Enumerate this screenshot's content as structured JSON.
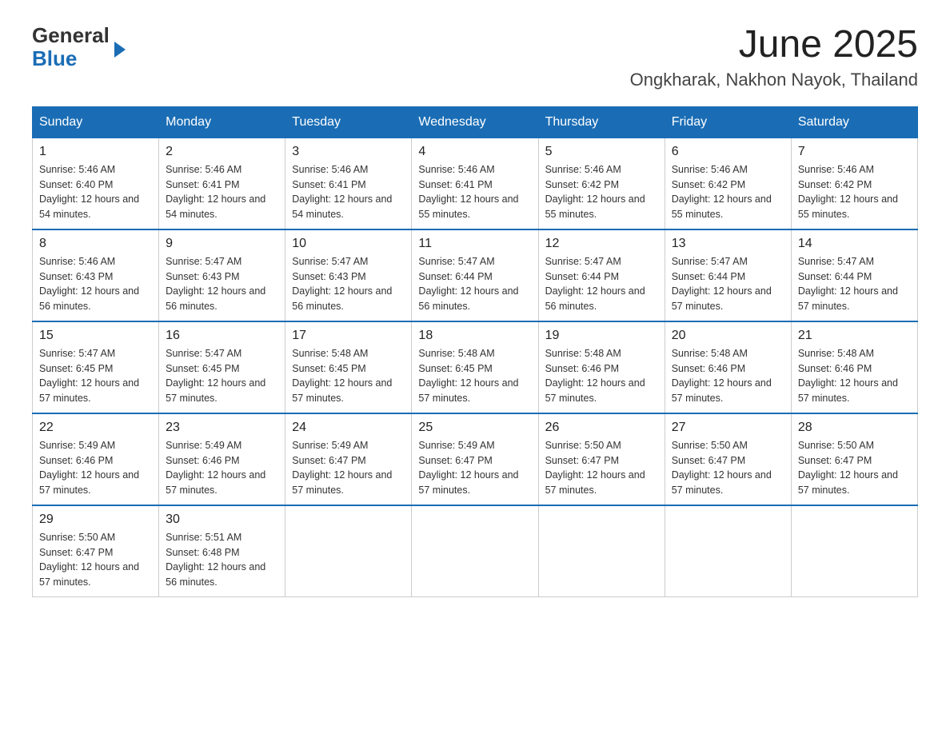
{
  "header": {
    "logo_general": "General",
    "logo_blue": "Blue",
    "title": "June 2025",
    "subtitle": "Ongkharak, Nakhon Nayok, Thailand"
  },
  "columns": [
    "Sunday",
    "Monday",
    "Tuesday",
    "Wednesday",
    "Thursday",
    "Friday",
    "Saturday"
  ],
  "weeks": [
    [
      {
        "day": "1",
        "sunrise": "5:46 AM",
        "sunset": "6:40 PM",
        "daylight": "12 hours and 54 minutes."
      },
      {
        "day": "2",
        "sunrise": "5:46 AM",
        "sunset": "6:41 PM",
        "daylight": "12 hours and 54 minutes."
      },
      {
        "day": "3",
        "sunrise": "5:46 AM",
        "sunset": "6:41 PM",
        "daylight": "12 hours and 54 minutes."
      },
      {
        "day": "4",
        "sunrise": "5:46 AM",
        "sunset": "6:41 PM",
        "daylight": "12 hours and 55 minutes."
      },
      {
        "day": "5",
        "sunrise": "5:46 AM",
        "sunset": "6:42 PM",
        "daylight": "12 hours and 55 minutes."
      },
      {
        "day": "6",
        "sunrise": "5:46 AM",
        "sunset": "6:42 PM",
        "daylight": "12 hours and 55 minutes."
      },
      {
        "day": "7",
        "sunrise": "5:46 AM",
        "sunset": "6:42 PM",
        "daylight": "12 hours and 55 minutes."
      }
    ],
    [
      {
        "day": "8",
        "sunrise": "5:46 AM",
        "sunset": "6:43 PM",
        "daylight": "12 hours and 56 minutes."
      },
      {
        "day": "9",
        "sunrise": "5:47 AM",
        "sunset": "6:43 PM",
        "daylight": "12 hours and 56 minutes."
      },
      {
        "day": "10",
        "sunrise": "5:47 AM",
        "sunset": "6:43 PM",
        "daylight": "12 hours and 56 minutes."
      },
      {
        "day": "11",
        "sunrise": "5:47 AM",
        "sunset": "6:44 PM",
        "daylight": "12 hours and 56 minutes."
      },
      {
        "day": "12",
        "sunrise": "5:47 AM",
        "sunset": "6:44 PM",
        "daylight": "12 hours and 56 minutes."
      },
      {
        "day": "13",
        "sunrise": "5:47 AM",
        "sunset": "6:44 PM",
        "daylight": "12 hours and 57 minutes."
      },
      {
        "day": "14",
        "sunrise": "5:47 AM",
        "sunset": "6:44 PM",
        "daylight": "12 hours and 57 minutes."
      }
    ],
    [
      {
        "day": "15",
        "sunrise": "5:47 AM",
        "sunset": "6:45 PM",
        "daylight": "12 hours and 57 minutes."
      },
      {
        "day": "16",
        "sunrise": "5:47 AM",
        "sunset": "6:45 PM",
        "daylight": "12 hours and 57 minutes."
      },
      {
        "day": "17",
        "sunrise": "5:48 AM",
        "sunset": "6:45 PM",
        "daylight": "12 hours and 57 minutes."
      },
      {
        "day": "18",
        "sunrise": "5:48 AM",
        "sunset": "6:45 PM",
        "daylight": "12 hours and 57 minutes."
      },
      {
        "day": "19",
        "sunrise": "5:48 AM",
        "sunset": "6:46 PM",
        "daylight": "12 hours and 57 minutes."
      },
      {
        "day": "20",
        "sunrise": "5:48 AM",
        "sunset": "6:46 PM",
        "daylight": "12 hours and 57 minutes."
      },
      {
        "day": "21",
        "sunrise": "5:48 AM",
        "sunset": "6:46 PM",
        "daylight": "12 hours and 57 minutes."
      }
    ],
    [
      {
        "day": "22",
        "sunrise": "5:49 AM",
        "sunset": "6:46 PM",
        "daylight": "12 hours and 57 minutes."
      },
      {
        "day": "23",
        "sunrise": "5:49 AM",
        "sunset": "6:46 PM",
        "daylight": "12 hours and 57 minutes."
      },
      {
        "day": "24",
        "sunrise": "5:49 AM",
        "sunset": "6:47 PM",
        "daylight": "12 hours and 57 minutes."
      },
      {
        "day": "25",
        "sunrise": "5:49 AM",
        "sunset": "6:47 PM",
        "daylight": "12 hours and 57 minutes."
      },
      {
        "day": "26",
        "sunrise": "5:50 AM",
        "sunset": "6:47 PM",
        "daylight": "12 hours and 57 minutes."
      },
      {
        "day": "27",
        "sunrise": "5:50 AM",
        "sunset": "6:47 PM",
        "daylight": "12 hours and 57 minutes."
      },
      {
        "day": "28",
        "sunrise": "5:50 AM",
        "sunset": "6:47 PM",
        "daylight": "12 hours and 57 minutes."
      }
    ],
    [
      {
        "day": "29",
        "sunrise": "5:50 AM",
        "sunset": "6:47 PM",
        "daylight": "12 hours and 57 minutes."
      },
      {
        "day": "30",
        "sunrise": "5:51 AM",
        "sunset": "6:48 PM",
        "daylight": "12 hours and 56 minutes."
      },
      null,
      null,
      null,
      null,
      null
    ]
  ]
}
